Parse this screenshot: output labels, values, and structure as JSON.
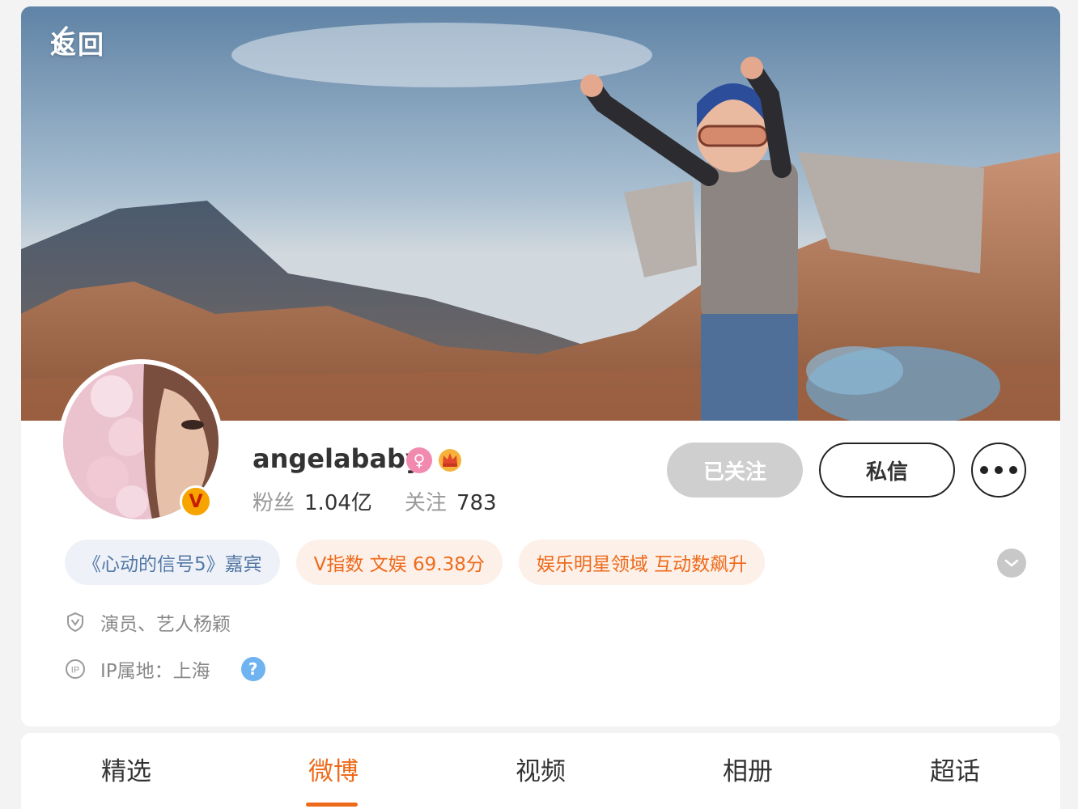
{
  "header": {
    "back_label": "返回"
  },
  "profile": {
    "name": "angelababy",
    "verified_badge": "V",
    "fans_label": "粉丝",
    "fans_count": "1.04亿",
    "following_label": "关注",
    "following_count": "783"
  },
  "actions": {
    "following_label": "已关注",
    "message_label": "私信"
  },
  "tags": [
    {
      "label": "《心动的信号5》嘉宾"
    },
    {
      "label": "V指数 文娱 69.38分"
    },
    {
      "label": "娱乐明星领域 互动数飙升"
    }
  ],
  "info": {
    "description": "演员、艺人杨颖",
    "ip_location": "IP属地：上海",
    "help_mark": "?"
  },
  "tabs": [
    {
      "label": "精选"
    },
    {
      "label": "微博"
    },
    {
      "label": "视频"
    },
    {
      "label": "相册"
    },
    {
      "label": "超话"
    }
  ],
  "active_tab_index": 1,
  "colors": {
    "accent": "#ee6a1b",
    "following_bg": "#cfcfcf",
    "tag_blue_text": "#5478a5",
    "tag_orange_text": "#ee6a1b"
  },
  "icons": {
    "back": "chevron-left-icon",
    "gender": "female-icon",
    "member": "crown-icon",
    "more": "more-dots-icon",
    "expand": "chevron-down-icon",
    "verified": "shield-check-icon",
    "ip": "ip-icon",
    "help": "help-icon"
  }
}
